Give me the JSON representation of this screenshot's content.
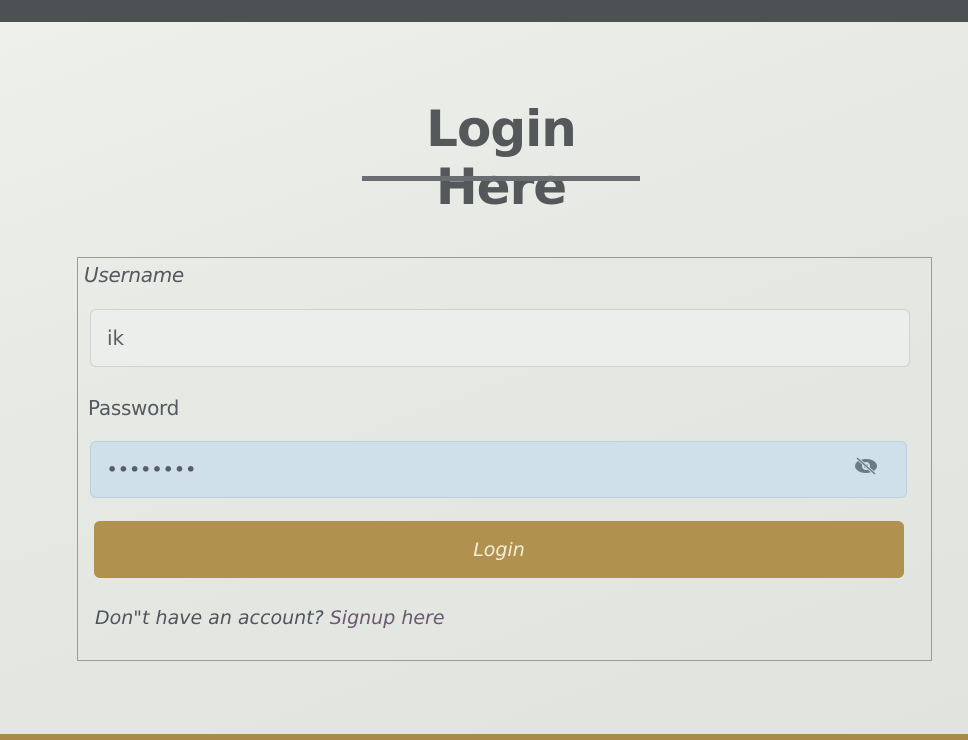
{
  "page": {
    "title": "Login Here"
  },
  "form": {
    "username_label": "Username",
    "username_value": "ik",
    "password_label": "Password",
    "password_value": "••••••••",
    "password_toggle_icon": "eye-slash-icon",
    "login_label": "Login",
    "signup_prompt": "Don\"t have an account?",
    "signup_link": "Signup here"
  },
  "colors": {
    "accent": "#b0924e",
    "password_field": "#cfe0ea",
    "title": "#55585a"
  }
}
